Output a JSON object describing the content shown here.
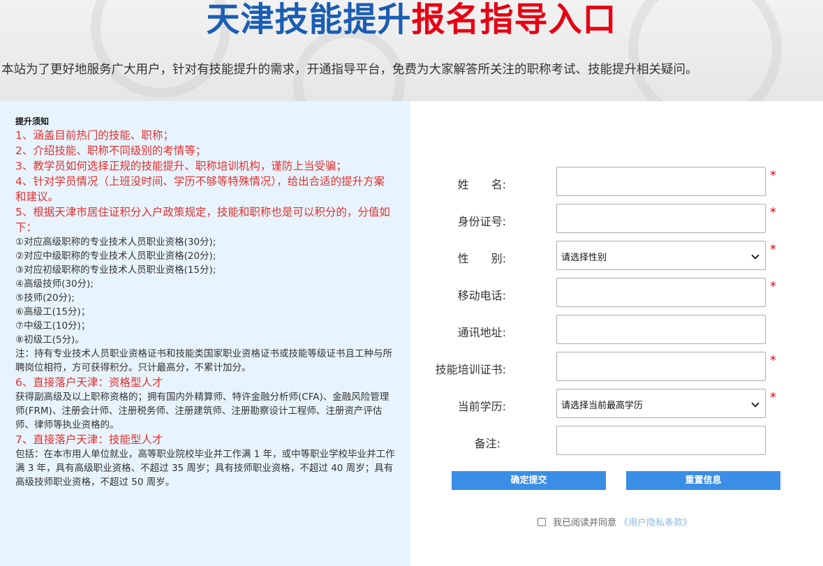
{
  "header": {
    "title_blue": "天津技能提升",
    "title_red": "报名指导入口",
    "intro": "本站为了更好地服务广大用户，针对有技能提升的需求，开通指导平台，免费为大家解答所关注的职称考试、技能提升相关疑问。"
  },
  "notice": {
    "title": "提升须知",
    "items": [
      "1、涵盖目前热门的技能、职称；",
      "2、介绍技能、职称不同级别的考情等；",
      "3、教学员如何选择正规的技能提升、职称培训机构，谨防上当受骗；",
      "4、针对学员情况（上班没时间、学历不够等特殊情况），给出合适的提升方案和建议。",
      "5、根据天津市居住证积分入户政策规定，技能和职称也是可以积分的，分值如下："
    ],
    "score_items": [
      "①对应高级职称的专业技术人员职业资格(30分);",
      "②对应中级职称的专业技术人员职业资格(20分);",
      "③对应初级职称的专业技术人员职业资格(15分);",
      "④高级技师(30分);",
      "⑤技师(20分);",
      "⑥高级工(15分)；",
      "⑦中级工(10分)；",
      "⑧初级工(5分)。"
    ],
    "score_note": "注：持有专业技术人员职业资格证书和技能类国家职业资格证书或技能等级证书且工种与所聘岗位相符，方可获得积分。只计最高分，不累计加分。",
    "item6": "6、直接落户天津：资格型人才",
    "item6_text": "获得副高级及以上职称资格的；拥有国内外精算师、特许金融分析师(CFA)、金融风险管理师(FRM)、注册会计师、注册税务师、注册建筑师、注册勘察设计工程师、注册资产评估师、律师等执业资格的。",
    "item7": "7、直接落户天津：技能型人才",
    "item7_text": "包括：在本市用人单位就业，高等职业院校毕业并工作满 1 年，或中等职业学校毕业并工作满 3 年，具有高级职业资格、不超过 35 周岁；具有技师职业资格，不超过 40 周岁；具有高级技师职业资格，不超过 50 周岁。"
  },
  "form": {
    "name_label": "姓　　名:",
    "id_label": "身份证号:",
    "gender_label": "性　　别:",
    "gender_value": "请选择性别",
    "phone_label": "移动电话:",
    "address_label": "通讯地址:",
    "cert_label": "技能培训证书:",
    "edu_label": "当前学历:",
    "edu_value": "请选择当前最高学历",
    "remark_label": "备注:",
    "required_mark": "*",
    "submit": "确定提交",
    "reset": "重置信息",
    "agree_text": "我已阅读并同意",
    "agree_link": "《用户隐私条款》"
  },
  "colors": {
    "title_blue": "#1a5db3",
    "title_red": "#e60012",
    "button": "#3a8ee6",
    "notice_red": "#e03030",
    "left_bg": "#e8f4fd"
  }
}
